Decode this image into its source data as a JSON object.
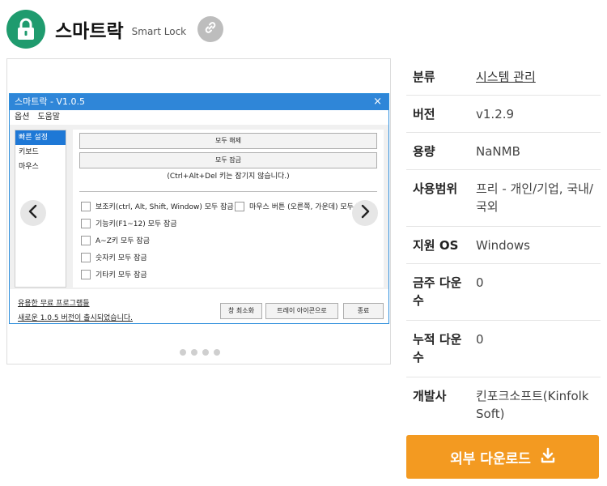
{
  "app": {
    "name": "스마트락",
    "name_en": "Smart Lock"
  },
  "screenshot": {
    "window_title": "스마트락 - V1.0.5",
    "close_glyph": "×",
    "menu": [
      "옵션",
      "도움말"
    ],
    "sidebar": [
      "빠른 설정",
      "키보드",
      "마우스"
    ],
    "buttons": {
      "unlock_all": "모두 해제",
      "lock_all": "모두 잠금"
    },
    "note": "(Ctrl+Alt+Del 키는 잠기지 않습니다.)",
    "checkboxes": [
      "보조키(ctrl, Alt, Shift, Window) 모두 잠금",
      "마우스 버튼 (오른쪽, 가운데) 모두 잠금",
      "기능키(F1~12) 모두 잠금",
      "A~Z키 모두 잠금",
      "숫자키 모두 잠금",
      "기타키 모두 잠금"
    ],
    "footer": {
      "link1": "유용한 무료 프로그램들",
      "link2": "새로운 1.0.5 버전이 출시되었습니다.",
      "btn_minimize": "창 최소화",
      "btn_tray": "트레이 아이콘으로",
      "btn_exit": "종료"
    }
  },
  "gallery": {
    "dot_count": 4,
    "active_dot": 0
  },
  "info": {
    "category_label": "분류",
    "category_value": "시스템 관리",
    "version_label": "버전",
    "version_value": "v1.2.9",
    "size_label": "용량",
    "size_value": "NaNMB",
    "license_label": "사용범위",
    "license_value": "프리 - 개인/기업, 국내/국외",
    "os_label": "지원 OS",
    "os_value": "Windows",
    "weekly_label": "금주 다운수",
    "weekly_value": "0",
    "total_label": "누적 다운수",
    "total_value": "0",
    "developer_label": "개발사",
    "developer_value": "킨포크소프트(Kinfolk Soft)"
  },
  "download_button": "외부 다운로드",
  "colors": {
    "accent_green": "#1f9b6e",
    "download_orange": "#f39a21",
    "win_blue": "#2f86d8"
  }
}
